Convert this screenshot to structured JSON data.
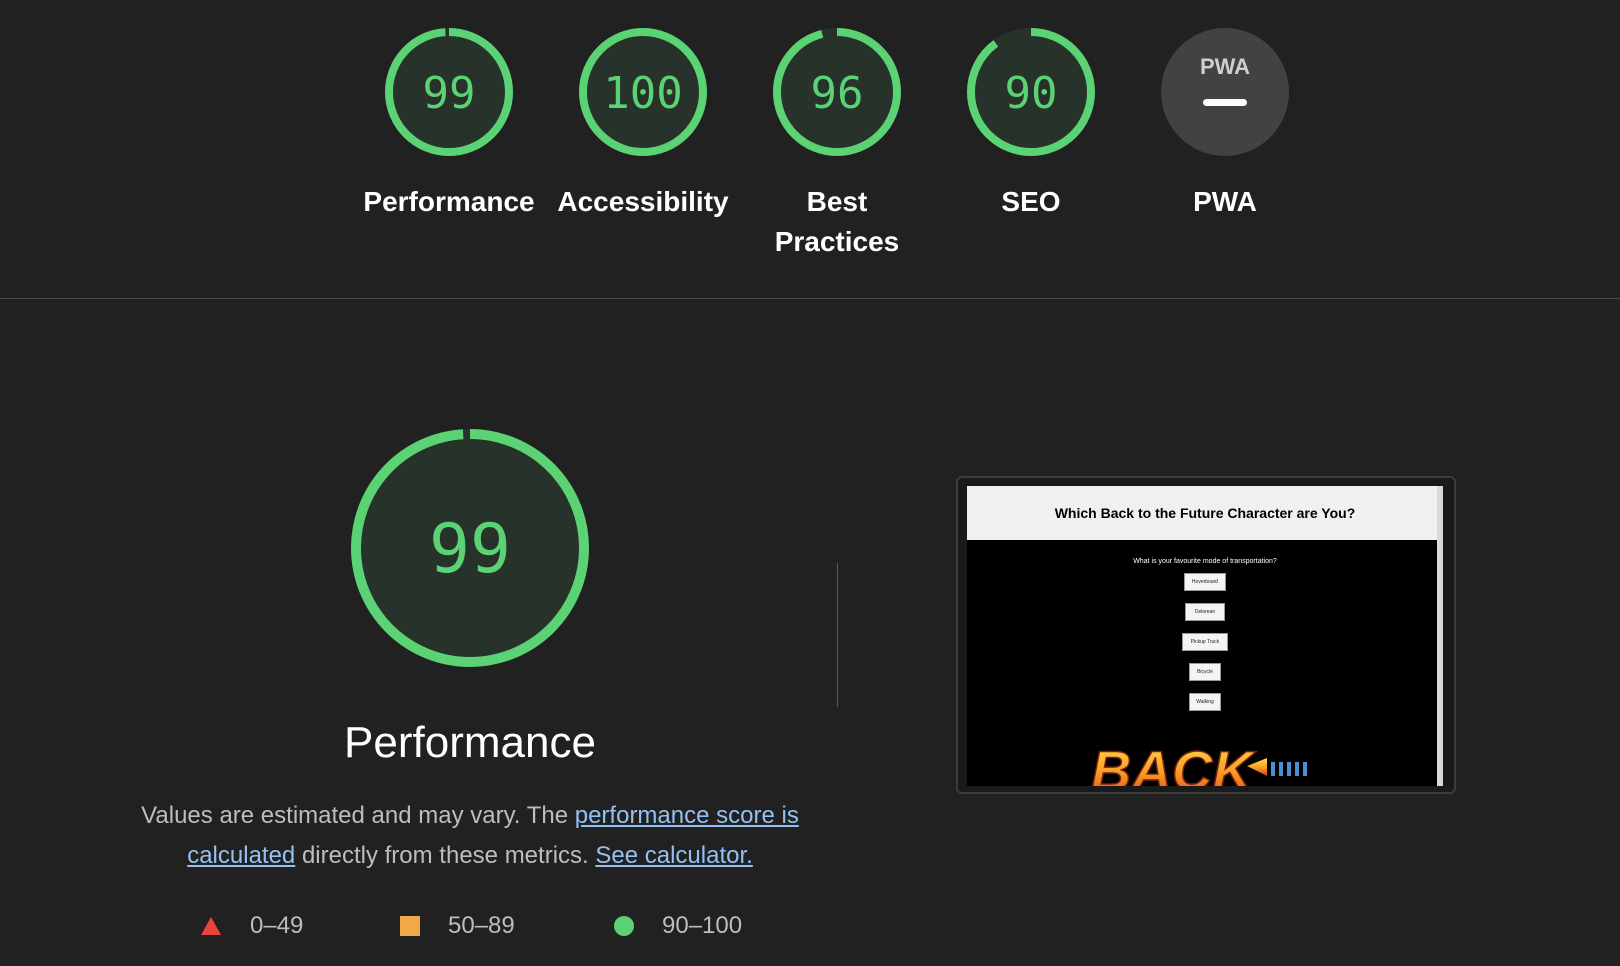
{
  "colors": {
    "background": "#212121",
    "pass": "#5bd374",
    "pass_fill": "#27322b",
    "average": "#f3a948",
    "fail": "#e8453c",
    "na": "#424242",
    "link": "#94c0f2"
  },
  "categories": [
    {
      "score": "99",
      "score_value": 99,
      "label": "Performance"
    },
    {
      "score": "100",
      "score_value": 100,
      "label": "Accessibility"
    },
    {
      "score": "96",
      "score_value": 96,
      "label": "Best Practices"
    },
    {
      "score": "90",
      "score_value": 90,
      "label": "SEO"
    },
    {
      "score": "",
      "badge": "PWA",
      "label": "PWA",
      "icon": "pwa-icon"
    }
  ],
  "performance": {
    "score": "99",
    "score_value": 99,
    "title": "Performance",
    "desc_prefix": "Values are estimated and may vary. The",
    "desc_link1": "performance score is calculated",
    "desc_middle": "directly from these metrics.",
    "desc_link2": "See calculator."
  },
  "legend": [
    {
      "range": "0–49",
      "icon": "triangle-icon"
    },
    {
      "range": "50–89",
      "icon": "square-icon"
    },
    {
      "range": "90–100",
      "icon": "circle-icon"
    }
  ],
  "thumbnail": {
    "page_title": "Which Back to the Future Character are You?",
    "question": "What is your favourite mode of transportation?",
    "options": [
      "Hoverboard",
      "Delorean",
      "Pickup Truck",
      "Bicycle",
      "Walking"
    ],
    "logo_text": "BACK"
  }
}
